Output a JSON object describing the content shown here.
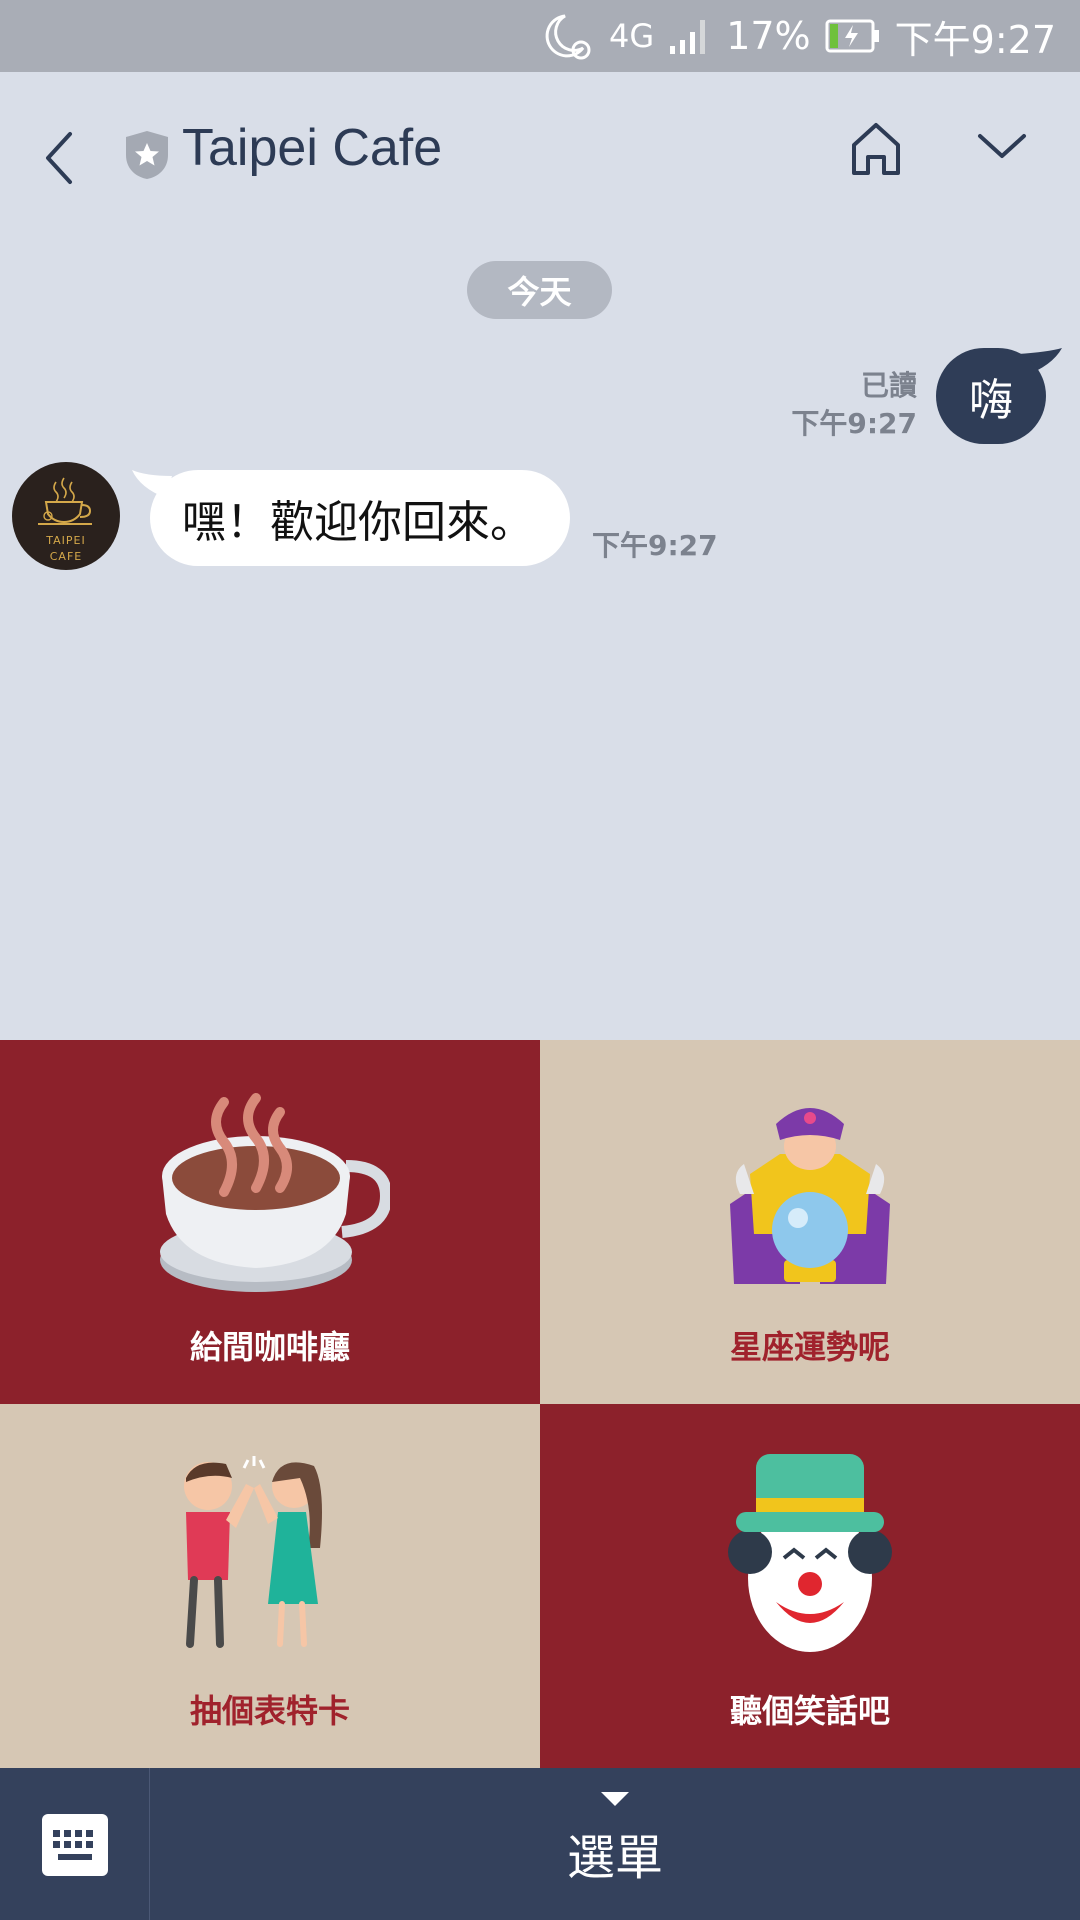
{
  "status_bar": {
    "network": "4G",
    "battery": "17%",
    "time": "下午9:27",
    "icons": [
      "moon-alarm-icon",
      "network-4g-icon",
      "signal-icon",
      "battery-charging-icon"
    ]
  },
  "header": {
    "title": "Taipei Cafe",
    "icons": [
      "back-icon",
      "shield-star-icon",
      "home-icon",
      "chevron-down-icon"
    ]
  },
  "chat": {
    "date_label": "今天",
    "sent": {
      "text": "嗨",
      "read_label": "已讀",
      "time": "下午9:27"
    },
    "received": {
      "text": "嘿！歡迎你回來。",
      "time": "下午9:27",
      "avatar_text": [
        "TAIPEI",
        "CAFE"
      ]
    }
  },
  "rich_menu": {
    "tiles": [
      {
        "label": "給間咖啡廳",
        "icon": "coffee-cup-icon"
      },
      {
        "label": "星座運勢呢",
        "icon": "fortune-teller-icon"
      },
      {
        "label": "抽個表特卡",
        "icon": "high-five-couple-icon"
      },
      {
        "label": "聽個笑話吧",
        "icon": "clown-icon"
      }
    ],
    "colors": {
      "red": "#8c212b",
      "beige": "#d6c7b4"
    }
  },
  "bottom_bar": {
    "menu_label": "選單",
    "icons": [
      "keyboard-icon",
      "caret-down-icon"
    ]
  }
}
